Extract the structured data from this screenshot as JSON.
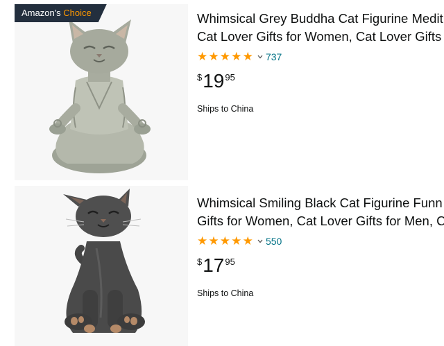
{
  "products": [
    {
      "badge": {
        "prefix": "Amazon's ",
        "accent": "Choice"
      },
      "title_line1": "Whimsical Grey Buddha Cat Figurine Medit",
      "title_line2": "Cat Lover Gifts for Women, Cat Lover Gifts",
      "rating_stars": 5,
      "review_count": "737",
      "price": {
        "symbol": "$",
        "whole": "19",
        "fraction": "95"
      },
      "shipping": "Ships to China",
      "image_icon": "grey-buddha-cat-figurine"
    },
    {
      "title_line1": "Whimsical Smiling Black Cat Figurine Funn",
      "title_line2": "Gifts for Women, Cat Lover Gifts for Men, C",
      "rating_stars": 5,
      "review_count": "550",
      "price": {
        "symbol": "$",
        "whole": "17",
        "fraction": "95"
      },
      "shipping": "Ships to China",
      "image_icon": "black-cat-figurine"
    }
  ],
  "colors": {
    "star": "#ff9900",
    "link": "#007185",
    "badge_bg": "#232f3e",
    "badge_accent": "#ff9900",
    "text": "#0f1111"
  }
}
